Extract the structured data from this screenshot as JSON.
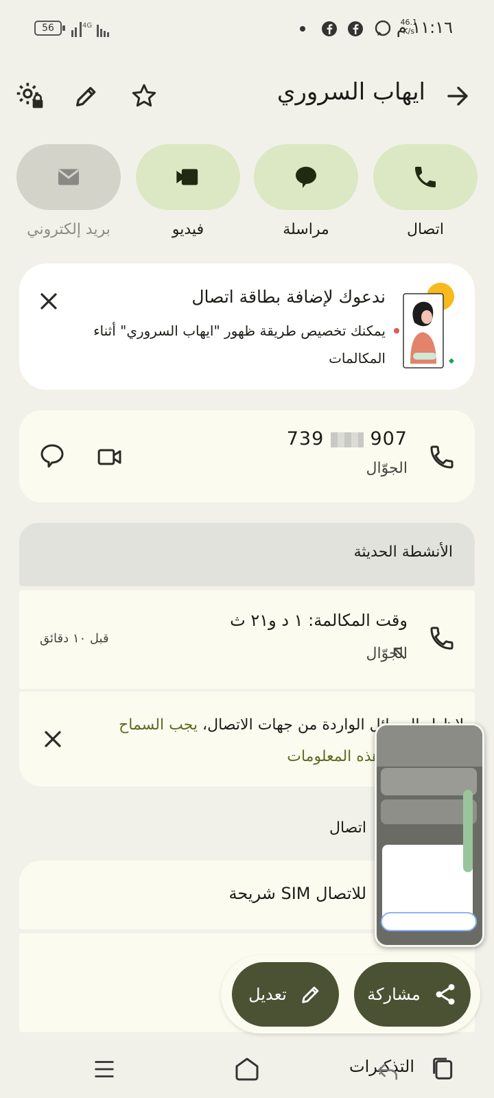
{
  "status_bar": {
    "time": "١١:١٦ م",
    "net_speed_value": "46.1",
    "net_speed_unit": "K/s",
    "battery_level": "56",
    "network": "4G"
  },
  "header": {
    "contact_name": "ايهاب السروري"
  },
  "actions": {
    "call_label": "اتصال",
    "message_label": "مراسلة",
    "video_label": "فيديو",
    "email_label": "بريد إلكتروني"
  },
  "promo": {
    "title": "ندعوك لإضافة بطاقة اتصال",
    "body": "يمكنك تخصيص طريقة ظهور \"ايهاب السروري\" أثناء المكالمات"
  },
  "phone": {
    "number_start": "739",
    "number_end": "907",
    "type": "الجوّال"
  },
  "recent": {
    "title": "الأنشطة الحديثة",
    "call_duration": "وقت المكالمة: ١ د و٢١ ث",
    "call_type": "الجوّال",
    "time_ago": "قبل ١٠ دقائق"
  },
  "permission": {
    "text": "لإظهار الرسائل الواردة من جهات الاتصال،",
    "link": "يجب السماح بالوصول إلى هذه المعلومات"
  },
  "about": {
    "section_title": "اتصال",
    "sim_text": "شريحة SIM للاتصال"
  },
  "fab": {
    "share_label": "مشاركة",
    "edit_label": "تعديل"
  },
  "bottom_nav": {
    "label": "التذكيرات"
  }
}
